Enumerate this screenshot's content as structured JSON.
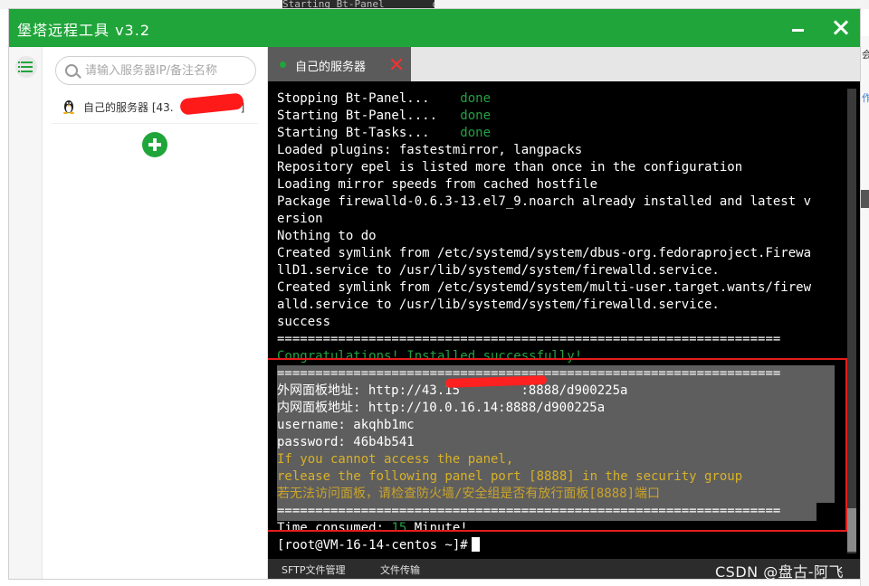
{
  "background": {
    "term_peek": "Starting Bt-Panel        done",
    "right_chars": [
      "会",
      "作"
    ]
  },
  "window": {
    "title": "堡塔远程工具 v3.2",
    "accent": "#20a53a"
  },
  "sidebar": {
    "search_placeholder": "请输入服务器IP/备注名称",
    "servers": [
      {
        "label": "自己的服务器 [43.",
        "suffix": "]"
      }
    ]
  },
  "tabs": [
    {
      "label": "自己的服务器",
      "status_color": "#20a53a"
    }
  ],
  "terminal": {
    "lines": [
      {
        "parts": [
          {
            "t": "Stopping Bt-Panel...    "
          },
          {
            "t": "done",
            "c": "g"
          }
        ]
      },
      {
        "parts": [
          {
            "t": "Starting Bt-Panel....   "
          },
          {
            "t": "done",
            "c": "g"
          }
        ]
      },
      {
        "parts": [
          {
            "t": "Starting Bt-Tasks...    "
          },
          {
            "t": "done",
            "c": "g"
          }
        ]
      },
      {
        "parts": [
          {
            "t": "Loaded plugins: fastestmirror, langpacks"
          }
        ]
      },
      {
        "parts": [
          {
            "t": "Repository epel is listed more than once in the configuration"
          }
        ]
      },
      {
        "parts": [
          {
            "t": "Loading mirror speeds from cached hostfile"
          }
        ]
      },
      {
        "parts": [
          {
            "t": "Package firewalld-0.6.3-13.el7_9.noarch already installed and latest v"
          }
        ]
      },
      {
        "parts": [
          {
            "t": "ersion"
          }
        ]
      },
      {
        "parts": [
          {
            "t": "Nothing to do"
          }
        ]
      },
      {
        "parts": [
          {
            "t": "Created symlink from /etc/systemd/system/dbus-org.fedoraproject.Firewa"
          }
        ]
      },
      {
        "parts": [
          {
            "t": "llD1.service to /usr/lib/systemd/system/firewalld.service."
          }
        ]
      },
      {
        "parts": [
          {
            "t": "Created symlink from /etc/systemd/system/multi-user.target.wants/firew"
          }
        ]
      },
      {
        "parts": [
          {
            "t": "alld.service to /usr/lib/systemd/system/firewalld.service."
          }
        ]
      },
      {
        "parts": [
          {
            "t": "success"
          }
        ]
      },
      {
        "parts": [
          {
            "t": "=================================================================="
          }
        ]
      },
      {
        "parts": [
          {
            "t": "Congratulations! Installed successfully!",
            "c": "g"
          }
        ]
      },
      {
        "parts": [
          {
            "t": "=================================================================="
          }
        ]
      },
      {
        "parts": [
          {
            "t": "外网面板地址: http://43.15",
            "c": ""
          },
          {
            "t": "        "
          },
          {
            "t": ":8888/d900225a"
          }
        ]
      },
      {
        "parts": [
          {
            "t": "内网面板地址: http://10.0.16.14:8888/d900225a"
          }
        ]
      },
      {
        "parts": [
          {
            "t": "username: akqhb1mc"
          }
        ]
      },
      {
        "parts": [
          {
            "t": "password: 46b4b541"
          }
        ]
      },
      {
        "parts": [
          {
            "t": "If you cannot access the panel,",
            "c": "y"
          }
        ]
      },
      {
        "parts": [
          {
            "t": "release the following panel port [8888] in the security group",
            "c": "y"
          }
        ]
      },
      {
        "parts": [
          {
            "t": "若无法访问面板，请检查防火墙/安全组是否有放行面板[8888]端口",
            "c": "y2"
          }
        ]
      },
      {
        "parts": [
          {
            "t": "=================================================================="
          }
        ]
      },
      {
        "parts": [
          {
            "t": "Time consumed: "
          },
          {
            "t": "15",
            "c": "g"
          },
          {
            "t": " Minute!"
          }
        ]
      }
    ],
    "prompt": "[root@VM-16-14-centos ~]#"
  },
  "bottom_bar": {
    "sftp_label": "SFTP文件管理",
    "transfer_label": "文件传输"
  },
  "watermark": "CSDN @盘古-阿飞"
}
